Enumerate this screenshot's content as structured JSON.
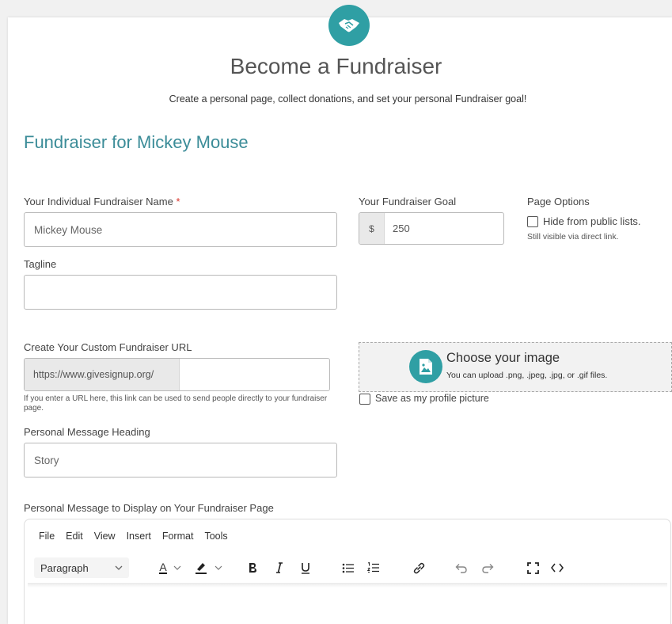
{
  "header": {
    "title": "Become a Fundraiser",
    "subtitle": "Create a personal page, collect donations, and set your personal Fundraiser goal!",
    "icon": "handshake-icon"
  },
  "section_title": "Fundraiser for Mickey Mouse",
  "fields": {
    "name": {
      "label": "Your Individual Fundraiser Name",
      "required_mark": "*",
      "value": "Mickey Mouse"
    },
    "goal": {
      "label": "Your Fundraiser Goal",
      "prefix": "$",
      "value": "250"
    },
    "page_options": {
      "label": "Page Options",
      "hide_label": "Hide from public lists.",
      "hide_note": "Still visible via direct link."
    },
    "tagline": {
      "label": "Tagline",
      "value": ""
    },
    "url": {
      "label": "Create Your Custom Fundraiser URL",
      "prefix": "https://www.givesignup.org/",
      "value": "",
      "help": "If you enter a URL here, this link can be used to send people directly to your fundraiser page."
    },
    "image": {
      "title": "Choose your image",
      "note": "You can upload .png, .jpeg, .jpg, or .gif files.",
      "profile_label": "Save as my profile picture"
    },
    "message_heading": {
      "label": "Personal Message Heading",
      "value": "Story"
    },
    "message": {
      "label": "Personal Message to Display on Your Fundraiser Page"
    }
  },
  "editor": {
    "menu": [
      "File",
      "Edit",
      "View",
      "Insert",
      "Format",
      "Tools"
    ],
    "block_format": "Paragraph",
    "text_color_label": "A"
  },
  "colors": {
    "accent": "#2f9fa4",
    "section_title": "#3b8c98",
    "required": "#d9342b"
  }
}
